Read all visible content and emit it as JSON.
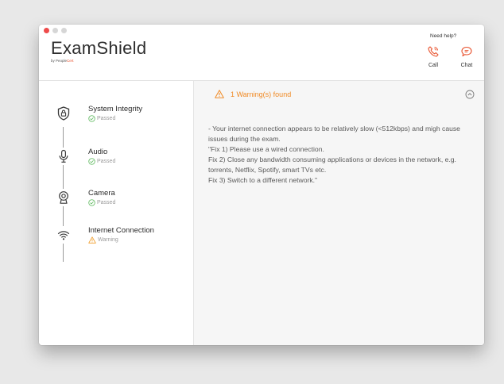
{
  "app": {
    "name": "ExamShield",
    "by": "by People",
    "brand": "Cert",
    "accent_color": "#f08a24"
  },
  "help": {
    "title": "Need help?",
    "call_label": "Call",
    "chat_label": "Chat",
    "icon_color": "#e8532f"
  },
  "checks": [
    {
      "name": "System Integrity",
      "status": "Passed",
      "icon": "shield-icon",
      "status_icon": "check-circle-icon"
    },
    {
      "name": "Audio",
      "status": "Passed",
      "icon": "microphone-icon",
      "status_icon": "check-circle-icon"
    },
    {
      "name": "Camera",
      "status": "Passed",
      "icon": "camera-icon",
      "status_icon": "check-circle-icon"
    },
    {
      "name": "Internet Connection",
      "status": "Warning",
      "icon": "wifi-icon",
      "status_icon": "warning-icon"
    }
  ],
  "status_colors": {
    "passed": "#5cb85c",
    "warning": "#f0a030"
  },
  "result": {
    "header": "1 Warning(s) found",
    "message_lines": [
      "- Your internet connection appears to be relatively slow (<512kbps) and migh cause issues during the exam.",
      "\"Fix 1) Please use a wired connection.",
      "Fix 2) Close any bandwidth consuming applications or devices in the network, e.g. torrents, Netflix, Spotify, smart TVs etc.",
      "Fix 3) Switch to a different network.\""
    ]
  }
}
